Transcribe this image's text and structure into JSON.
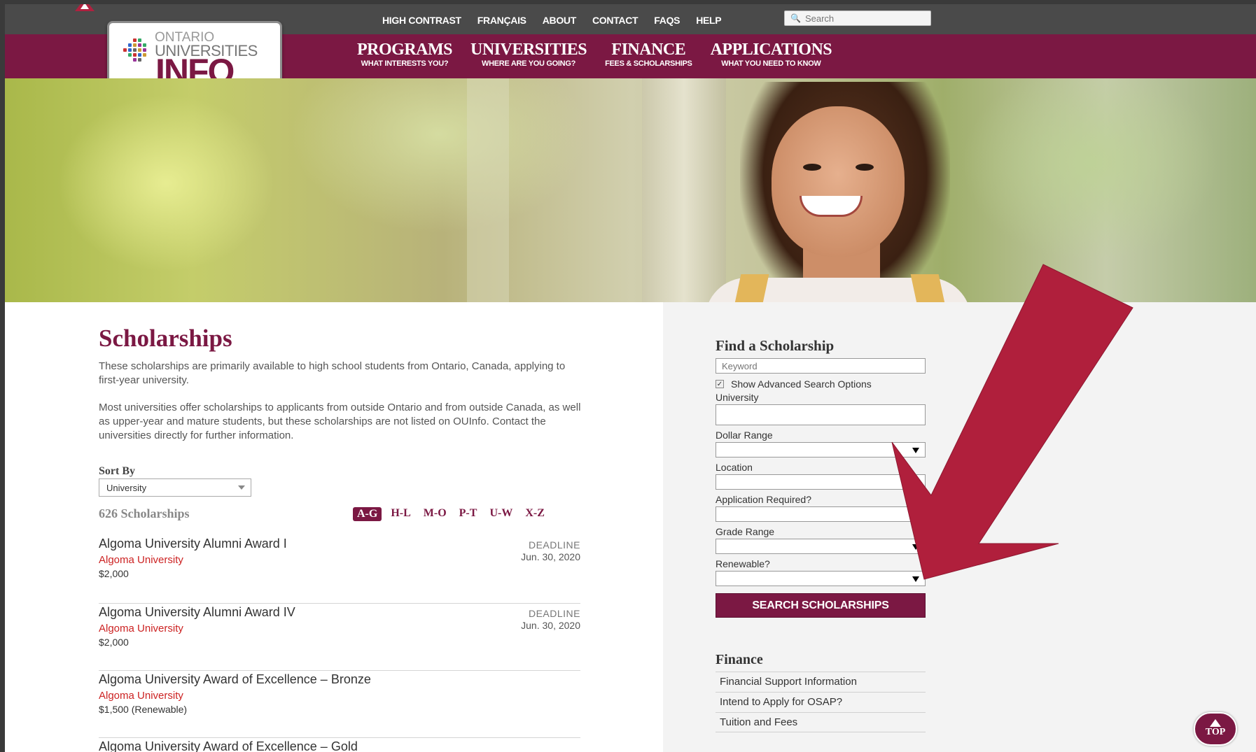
{
  "util_nav": {
    "links": [
      "HIGH CONTRAST",
      "FRANÇAIS",
      "ABOUT",
      "CONTACT",
      "FAQS",
      "HELP"
    ],
    "search_placeholder": "Search"
  },
  "logo": {
    "line1": "ONTARIO",
    "line2": "UNIVERSITIES",
    "line3": "INFO"
  },
  "main_nav": [
    {
      "label": "PROGRAMS",
      "sub": "WHAT INTERESTS YOU?"
    },
    {
      "label": "UNIVERSITIES",
      "sub": "WHERE ARE YOU GOING?"
    },
    {
      "label": "FINANCE",
      "sub": "FEES & SCHOLARSHIPS"
    },
    {
      "label": "APPLICATIONS",
      "sub": "WHAT YOU NEED TO KNOW"
    }
  ],
  "page": {
    "title": "Scholarships",
    "intro1": "These scholarships are primarily available to high school students from Ontario, Canada, applying to first-year university.",
    "intro2": "Most universities offer scholarships to applicants from outside Ontario and from outside Canada, as well as upper-year and mature students, but these scholarships are not listed on OUInfo. Contact the universities directly for further information.",
    "sort_label": "Sort By",
    "sort_value": "University",
    "count": "626 Scholarships",
    "alpha_filters": [
      "A-G",
      "H-L",
      "M-O",
      "P-T",
      "U-W",
      "X-Z"
    ],
    "alpha_active": "A-G"
  },
  "results": [
    {
      "name": "Algoma University Alumni Award I",
      "university": "Algoma University",
      "amount": "$2,000",
      "deadline_label": "DEADLINE",
      "deadline": "Jun. 30, 2020"
    },
    {
      "name": "Algoma University Alumni Award IV",
      "university": "Algoma University",
      "amount": "$2,000",
      "deadline_label": "DEADLINE",
      "deadline": "Jun. 30, 2020"
    },
    {
      "name": "Algoma University Award of Excellence – Bronze",
      "university": "Algoma University",
      "amount": "$1,500 (Renewable)",
      "deadline_label": "",
      "deadline": ""
    },
    {
      "name": "Algoma University Award of Excellence – Gold",
      "university": "",
      "amount": "",
      "deadline_label": "",
      "deadline": ""
    }
  ],
  "find": {
    "title": "Find a Scholarship",
    "keyword_placeholder": "Keyword",
    "advanced_label": "Show Advanced Search Options",
    "university_label": "University",
    "dollar_label": "Dollar Range",
    "location_label": "Location",
    "application_label": "Application Required?",
    "grade_label": "Grade Range",
    "renewable_label": "Renewable?",
    "button": "SEARCH SCHOLARSHIPS"
  },
  "finance": {
    "title": "Finance",
    "links": [
      "Financial Support Information",
      "Intend to Apply for OSAP?",
      "Tuition and Fees"
    ]
  },
  "top_button": "TOP",
  "colors": {
    "brand": "#7b1843",
    "annotation_arrow": "#b01f3c",
    "util_bar": "#4a4a4a"
  }
}
